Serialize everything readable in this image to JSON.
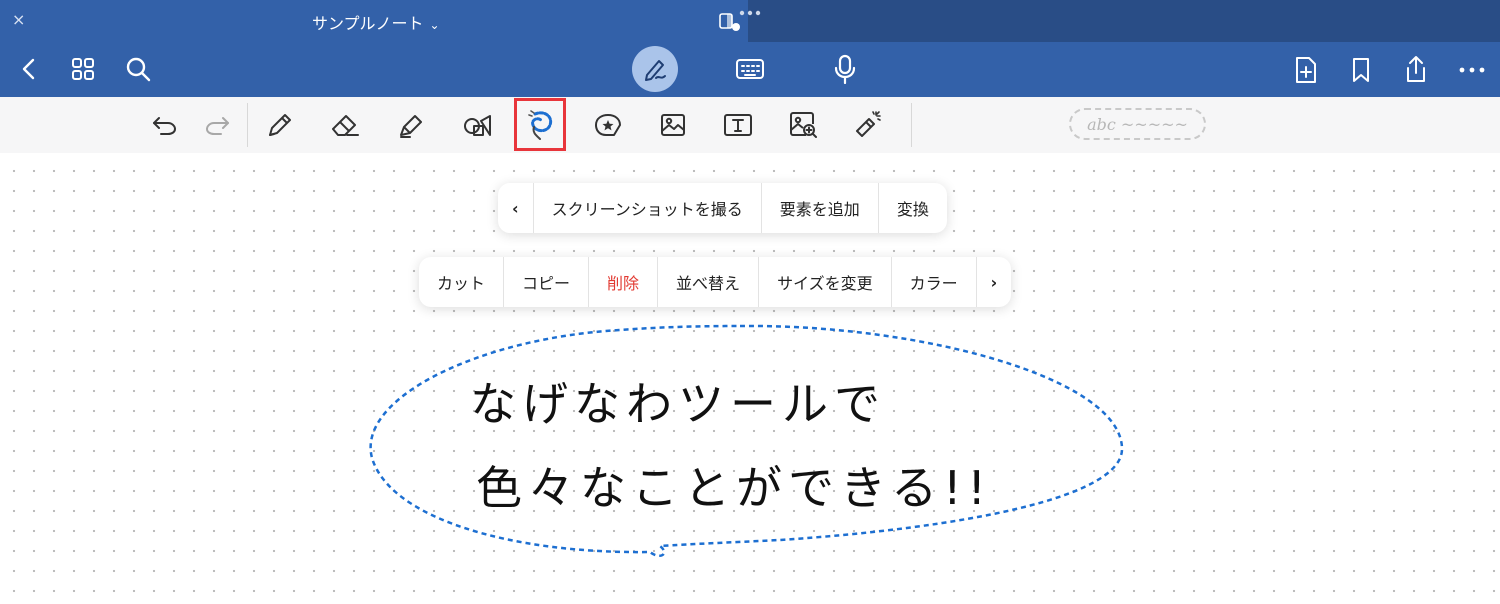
{
  "app": {
    "title": "サンプルノート",
    "title_chevron": "⌄",
    "close_label": "×"
  },
  "colors": {
    "header_blue": "#3361a9",
    "header_dark": "#294d86",
    "accent_red": "#e8353b",
    "lasso_blue": "#1d6fd1",
    "danger_red": "#e23b33"
  },
  "icons": {
    "top_left": [
      "chevron-left-icon",
      "grid-icon",
      "search-icon"
    ],
    "top_center": [
      "pen-icon",
      "keyboard-icon",
      "microphone-icon"
    ],
    "top_right": [
      "add-page-icon",
      "bookmark-icon",
      "share-icon",
      "more-icon"
    ],
    "tools": [
      "undo-icon",
      "redo-icon",
      "pencil-icon",
      "eraser-icon",
      "highlighter-icon",
      "shapes-icon",
      "lasso-icon",
      "sticker-icon",
      "image-icon",
      "textbox-icon",
      "image-search-icon",
      "laser-pointer-icon"
    ]
  },
  "toolstrip": {
    "handwriting_preview": "abc ~~~~~"
  },
  "menu_top": {
    "back_arrow": "‹",
    "items": [
      "スクリーンショットを撮る",
      "要素を追加",
      "変換"
    ]
  },
  "menu_bottom": {
    "items": [
      "カット",
      "コピー",
      "削除",
      "並べ替え",
      "サイズを変更",
      "カラー"
    ],
    "forward_arrow": "›"
  },
  "canvas": {
    "handwriting_line1": "なげなわツールで",
    "handwriting_line2": "色々なことができる!!"
  }
}
